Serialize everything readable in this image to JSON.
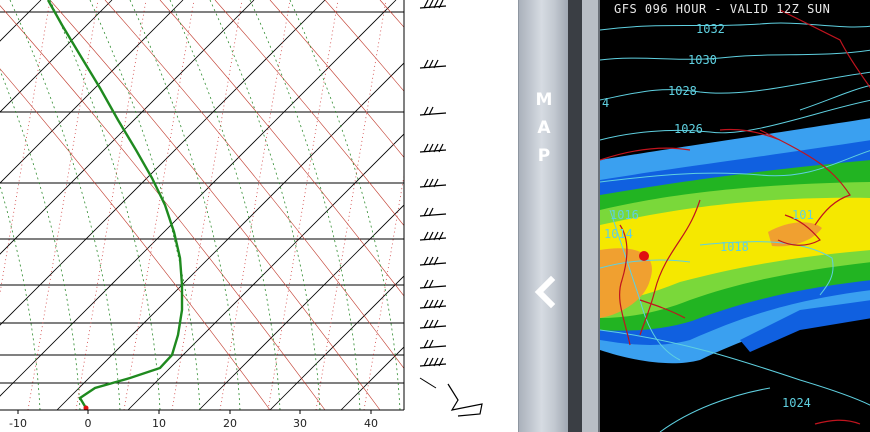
{
  "skewt": {
    "temp_ticks": [
      "-10",
      "0",
      "10",
      "20",
      "30",
      "40"
    ],
    "colors": {
      "isotherm": "#000000",
      "isobar": "#000000",
      "dry_adiabat": "#c0392b",
      "moist_adiabat": "#2e8b2e",
      "mixing_ratio": "#d04040",
      "profile": "#1f8a1f"
    }
  },
  "divider": {
    "map_letters": [
      "M",
      "A",
      "P"
    ],
    "collapse_icon": "chevron-left-icon"
  },
  "map": {
    "title": "GFS 096 HOUR - VALID 12Z SUN",
    "isobars": [
      "1032",
      "1030",
      "1028",
      "1026",
      "1016",
      "1014",
      "1018",
      "101",
      "1024",
      "4"
    ],
    "colors": {
      "background": "#000000",
      "isobar": "#5fd0e0",
      "coast": "#c0141e",
      "precip_light": "#3aa0f0",
      "precip_mod": "#1060e0",
      "precip_green": "#22b422",
      "precip_lgreen": "#7ad83a",
      "precip_yellow": "#f5e800",
      "precip_orange": "#f0a030"
    }
  }
}
